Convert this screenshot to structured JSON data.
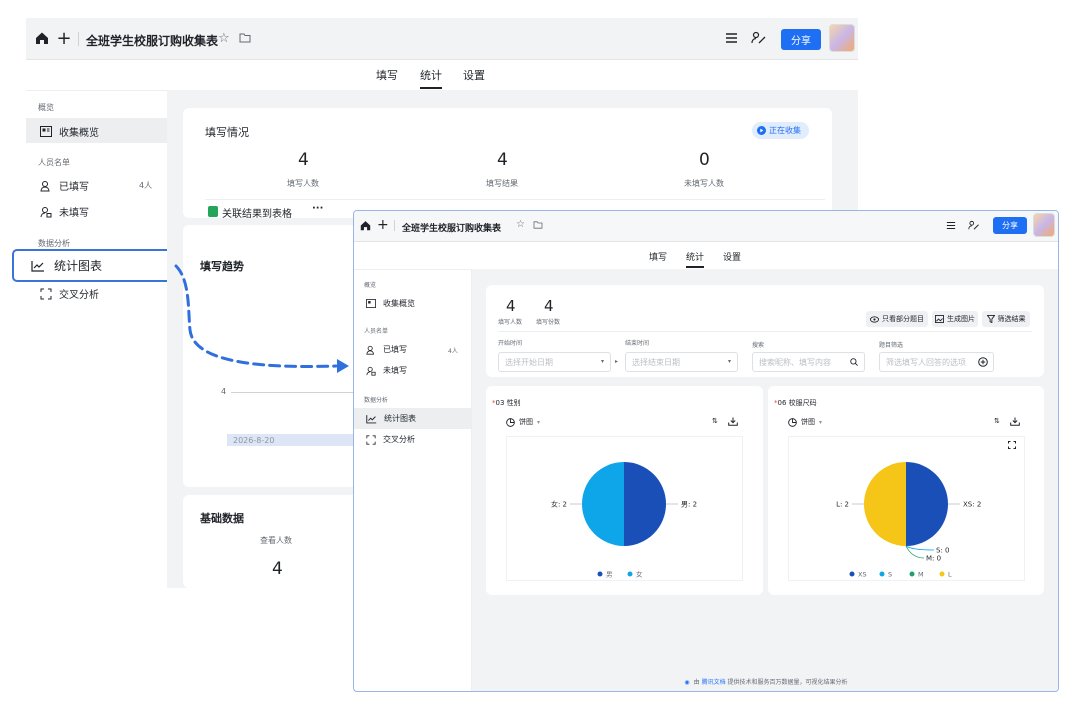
{
  "doc": {
    "title": "全班学生校服订购收集表",
    "share_label": "分享"
  },
  "tabs": [
    "填写",
    "统计",
    "设置"
  ],
  "sidebar": {
    "sec_overview": "概览",
    "overview_item": "收集概览",
    "sec_people": "人员名单",
    "filled_label": "已填写",
    "filled_count": "4人",
    "unfilled_label": "未填写",
    "sec_analysis": "数据分析",
    "chart_item": "统计图表",
    "cross_item": "交叉分析"
  },
  "bg": {
    "fill_status_title": "填写情况",
    "collecting_badge": "正在收集",
    "stats": [
      {
        "value": "4",
        "label": "填写人数"
      },
      {
        "value": "4",
        "label": "填写结果"
      },
      {
        "value": "0",
        "label": "未填写人数"
      }
    ],
    "link_table": "关联结果到表格",
    "more": "···",
    "trend_title": "填写趋势",
    "trend_tick": "4",
    "trend_date": "2026-8-20",
    "basic_title": "基础数据",
    "view_count_label": "查看人数",
    "view_count_value": "4"
  },
  "fg": {
    "fill_people_value": "4",
    "fill_people_label": "填写人数",
    "fill_count_value": "4",
    "fill_count_label": "填写份数",
    "only_part_btn": "只看部分题目",
    "gen_image_btn": "生成图片",
    "filter_btn": "筛选结果",
    "start_time_label": "开始时间",
    "start_time_placeholder": "选择开始日期",
    "end_time_label": "结束时间",
    "end_time_placeholder": "选择结束日期",
    "search_label": "搜索",
    "search_placeholder": "搜索昵称、填写内容",
    "question_filter_label": "题目筛选",
    "question_filter_placeholder": "筛选填写人回答的选项",
    "pie_type": "饼图",
    "q1_num": "03",
    "q1_title": "性别",
    "q2_num": "06",
    "q2_title": "校服尺码",
    "footer_prefix": "由",
    "footer_brand": "腾讯文档",
    "footer_suffix": "提供技术和服务百万数据量，可视化结果分析"
  },
  "chart_data": [
    {
      "type": "pie",
      "title": "03 性别",
      "categories": [
        "男",
        "女"
      ],
      "values": [
        2,
        2
      ],
      "colors": [
        "#1b4fb8",
        "#0ea5e9"
      ],
      "labels": [
        "男: 2",
        "女: 2"
      ]
    },
    {
      "type": "pie",
      "title": "06 校服尺码",
      "categories": [
        "XS",
        "S",
        "M",
        "L"
      ],
      "values": [
        2,
        0,
        0,
        2
      ],
      "colors": [
        "#1b4fb8",
        "#0ea5e9",
        "#22a06b",
        "#f5c518"
      ],
      "labels": [
        "XS: 2",
        "S: 0",
        "M: 0",
        "L: 2"
      ]
    }
  ]
}
